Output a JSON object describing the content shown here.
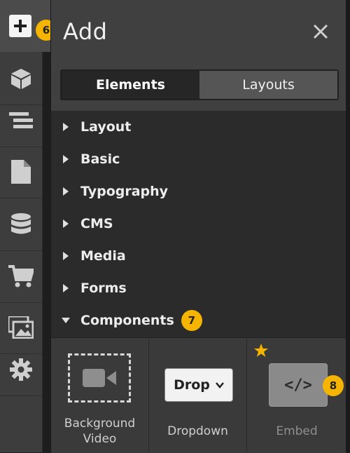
{
  "rail": {
    "items": [
      {
        "icon": "plus-icon",
        "badge": "6"
      },
      {
        "icon": "cube-icon"
      },
      {
        "icon": "navigator-icon"
      },
      {
        "icon": "page-icon"
      },
      {
        "icon": "database-icon"
      },
      {
        "icon": "cart-icon"
      },
      {
        "icon": "assets-icon"
      },
      {
        "icon": "gear-icon"
      }
    ]
  },
  "panel": {
    "title": "Add",
    "close_icon": "close-icon",
    "tabs": [
      {
        "label": "Elements",
        "active": true
      },
      {
        "label": "Layouts",
        "active": false
      }
    ],
    "categories": [
      {
        "label": "Layout",
        "expanded": false
      },
      {
        "label": "Basic",
        "expanded": false
      },
      {
        "label": "Typography",
        "expanded": false
      },
      {
        "label": "CMS",
        "expanded": false
      },
      {
        "label": "Media",
        "expanded": false
      },
      {
        "label": "Forms",
        "expanded": false
      },
      {
        "label": "Components",
        "expanded": true,
        "badge": "7"
      }
    ],
    "components": [
      {
        "label": "Background Video",
        "label_line1": "Background",
        "label_line2": "Video",
        "icon": "video-camera-icon"
      },
      {
        "label": "Dropdown",
        "icon": "dropdown-icon",
        "icon_text": "Drop"
      },
      {
        "label": "Embed",
        "icon": "code-icon",
        "icon_text": "</>",
        "starred": true,
        "badge": "8"
      }
    ]
  },
  "colors": {
    "badge": "#f5b400",
    "star": "#f5b400",
    "panel_bg": "#2b2b2b",
    "header_bg": "#404040"
  }
}
